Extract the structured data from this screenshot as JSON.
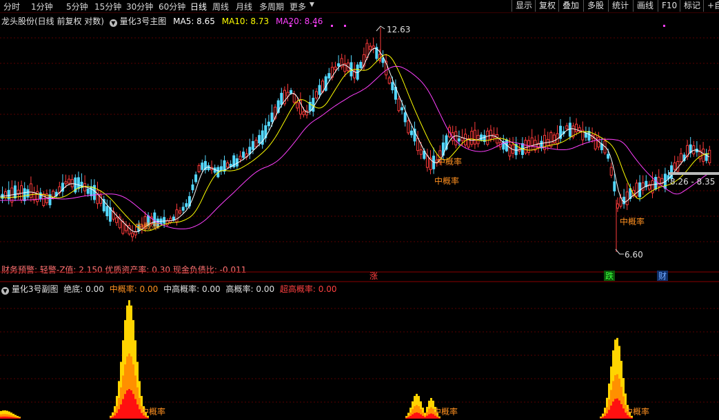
{
  "toolbar": {
    "timeframes": [
      "分时",
      "1分钟",
      "5分钟",
      "15分钟",
      "30分钟",
      "60分钟",
      "日线",
      "周线",
      "月线",
      "多周期",
      "更多"
    ],
    "active_index": 6,
    "buttons": [
      "显示",
      "复权",
      "叠加",
      "多股",
      "统计",
      "画线",
      "F10",
      "标记",
      "+自"
    ]
  },
  "main": {
    "stock_title": "龙头股份(日线 前复权 对数)",
    "indicator_name": "量化3号主图",
    "ma5_label": "MA5: 8.65",
    "ma10_label": "MA10: 8.73",
    "ma20_label": "MA20: 8.46",
    "high_label": "12.63",
    "low_label": "6.60",
    "range_label": "8.26 - 8.35",
    "signal_label": "中概率",
    "finance_text": "财务预警: 轻警-Z值: 2.150 优质资产率: 0.30 现金负债比: -0.011",
    "markers": [
      {
        "text": "涨",
        "color": "#ff4040"
      },
      {
        "text": "跌",
        "color": "#3cff3c"
      },
      {
        "text": "财",
        "color": "#6fa8ff"
      }
    ]
  },
  "sub": {
    "indicator_name": "量化3号副图",
    "absolute_bottom": "绝底: 0.00",
    "mid_prob": "中概率: 0.00",
    "mid_high_prob": "中高概率: 0.00",
    "high_prob": "高概率: 0.00",
    "super_high_prob": "超高概率: 0.00",
    "signal_label": "中概率"
  },
  "colors": {
    "up": "#ff3b3b",
    "down": "#54d8ff",
    "ma5": "#ffffff",
    "ma10": "#ffff00",
    "ma20": "#ff40ff",
    "signal": "#ff9020"
  }
}
